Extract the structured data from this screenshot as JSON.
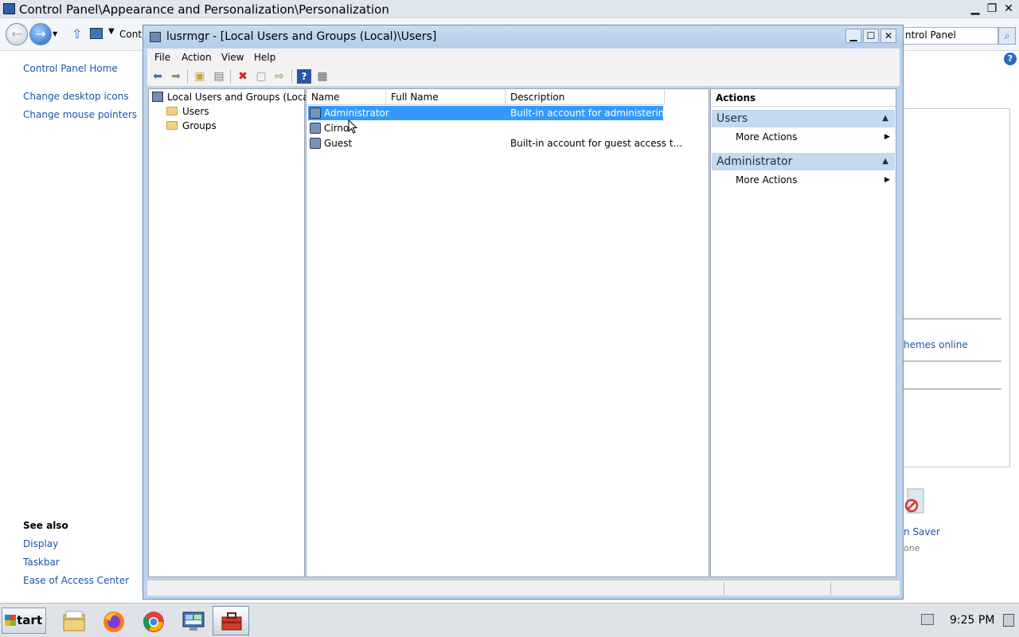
{
  "background_window": {
    "title": "Control Panel\\Appearance and Personalization\\Personalization",
    "address_crumb": "Cont",
    "search_value": "ntrol Panel",
    "links": [
      "Control Panel Home",
      "Change desktop icons",
      "Change mouse pointers"
    ],
    "see_also_heading": "See also",
    "see_also_links": [
      "Display",
      "Taskbar",
      "Ease of Access Center"
    ],
    "themes_online": "hemes online",
    "screen_saver_label": "n Saver",
    "screen_saver_value": "one"
  },
  "window": {
    "title": "lusrmgr - [Local Users and Groups (Local)\\Users]",
    "menu": [
      "File",
      "Action",
      "View",
      "Help"
    ]
  },
  "tree": {
    "root": "Local Users and Groups (Local)",
    "items": [
      "Users",
      "Groups"
    ]
  },
  "list": {
    "columns": [
      "Name",
      "Full Name",
      "Description"
    ],
    "rows": [
      {
        "name": "Administrator",
        "full_name": "",
        "description": "Built-in account for administering..."
      },
      {
        "name": "Cirno",
        "full_name": "",
        "description": ""
      },
      {
        "name": "Guest",
        "full_name": "",
        "description": "Built-in account for guest access t..."
      }
    ],
    "selected_row": 0
  },
  "actions": {
    "header": "Actions",
    "sections": [
      {
        "title": "Users",
        "item": "More Actions"
      },
      {
        "title": "Administrator",
        "item": "More Actions"
      }
    ]
  },
  "taskbar": {
    "start_label": "Start",
    "clock": "9:25 PM",
    "apps": [
      "file-explorer",
      "firefox",
      "chrome",
      "control-panel",
      "toolbox"
    ]
  },
  "colors": {
    "selection": "#3399ff",
    "action_section": "#c5d9ef",
    "link": "#1a55a5"
  }
}
